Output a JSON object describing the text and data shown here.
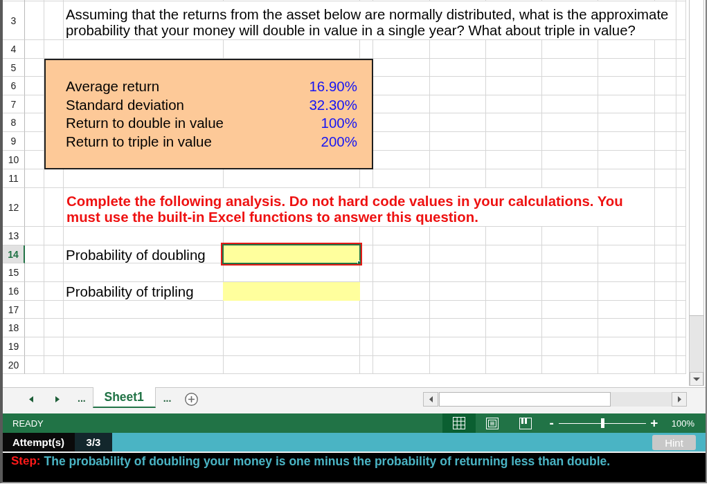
{
  "sheet": {
    "row_headers": [
      {
        "label": "3",
        "selected": false
      },
      {
        "label": "4",
        "selected": false
      },
      {
        "label": "5",
        "selected": false
      },
      {
        "label": "6",
        "selected": false
      },
      {
        "label": "7",
        "selected": false
      },
      {
        "label": "8",
        "selected": false
      },
      {
        "label": "9",
        "selected": false
      },
      {
        "label": "10",
        "selected": false
      },
      {
        "label": "11",
        "selected": false
      },
      {
        "label": "12",
        "selected": false
      },
      {
        "label": "13",
        "selected": false
      },
      {
        "label": "14",
        "selected": true
      },
      {
        "label": "15",
        "selected": false
      },
      {
        "label": "16",
        "selected": false
      },
      {
        "label": "17",
        "selected": false
      },
      {
        "label": "18",
        "selected": false
      },
      {
        "label": "19",
        "selected": false
      },
      {
        "label": "20",
        "selected": false
      }
    ],
    "question": "Assuming that the returns from the asset below are normally distributed, what is the approximate probability that your money will double in value in a single year? What about triple in value?",
    "inputs": [
      {
        "label": "Average return",
        "value": "16.90%"
      },
      {
        "label": "Standard deviation",
        "value": "32.30%"
      },
      {
        "label": "Return to double in value",
        "value": "100%"
      },
      {
        "label": "Return to triple in value",
        "value": "200%"
      }
    ],
    "instruction": "Complete the following analysis. Do not hard code values in your calculations. You must use the built-in Excel functions to answer this question.",
    "answers": [
      {
        "label": "Probability of doubling",
        "selected": true
      },
      {
        "label": "Probability of tripling",
        "selected": false
      }
    ]
  },
  "sheet_tabs": {
    "more_before": "...",
    "tabs": [
      {
        "label": "Sheet1",
        "selected": true
      }
    ],
    "more_after": "..."
  },
  "status_bar": {
    "mode": "READY",
    "views": [
      {
        "kind": "normal",
        "selected": true
      },
      {
        "kind": "page_layout",
        "selected": false
      },
      {
        "kind": "page_break",
        "selected": false
      }
    ],
    "zoom_out": "-",
    "zoom": {
      "level": 0.5
    },
    "zoom_in": "+",
    "zoom_reading": "100%"
  },
  "attempts": {
    "label": "Attempt(s)",
    "value": "3/3"
  },
  "hint_button": {
    "label": "Hint",
    "disabled": true
  },
  "step": {
    "label": "Step:",
    "text": "The probability of doubling your money is one minus the probability of returning less than double."
  }
}
